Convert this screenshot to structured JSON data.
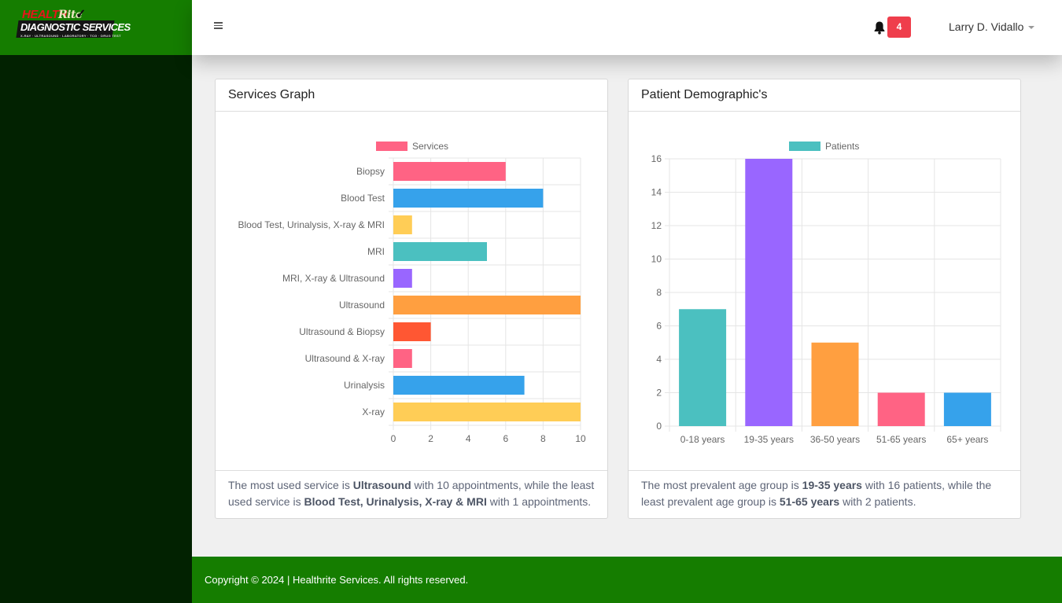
{
  "brand": {
    "logo_line1": "HEALTH",
    "logo_line1b": "Rite",
    "logo_line2": "DIAGNOSTIC SERVICES",
    "logo_line3": "X-RAY · ULTRASOUND · LABORATORY · TCG · DRUG TEST"
  },
  "header": {
    "notification_count": "4",
    "user_name": "Larry D. Vidallo"
  },
  "services_card": {
    "title": "Services Graph",
    "summary": {
      "t1": "The most used service is ",
      "most_service": "Ultrasound",
      "t2": " with 10 appointments, while the least used service is ",
      "least_service": "Blood Test, Urinalysis, X-ray & MRI",
      "t3": " with 1 appointments."
    }
  },
  "demographics_card": {
    "title": "Patient Demographic's",
    "summary": {
      "t1": "The most prevalent age group is ",
      "most_group": "19-35 years",
      "t2": " with 16 patients, while the least prevalent age group is ",
      "least_group": "51-65 years",
      "t3": " with 2 patients."
    }
  },
  "chart_data": [
    {
      "type": "bar",
      "orientation": "horizontal",
      "categories": [
        "Biopsy",
        "Blood Test",
        "Blood Test, Urinalysis, X-ray & MRI",
        "MRI",
        "MRI, X-ray & Ultrasound",
        "Ultrasound",
        "Ultrasound & Biopsy",
        "Ultrasound & X-ray",
        "Urinalysis",
        "X-ray"
      ],
      "series": [
        {
          "name": "Services",
          "values": [
            6,
            8,
            1,
            5,
            1,
            10,
            2,
            1,
            7,
            10
          ]
        }
      ],
      "colors": [
        "#ff6384",
        "#36a2eb",
        "#ffcd56",
        "#4bc0c0",
        "#9966ff",
        "#ff9f40",
        "#ff5733",
        "#ff6384",
        "#36a2eb",
        "#ffcd56"
      ],
      "legend_color": "#ff6384",
      "xlim": [
        0,
        10
      ],
      "xticks": [
        0,
        2,
        4,
        6,
        8,
        10
      ],
      "grid": true,
      "legend": "top"
    },
    {
      "type": "bar",
      "orientation": "vertical",
      "categories": [
        "0-18 years",
        "19-35 years",
        "36-50 years",
        "51-65 years",
        "65+ years"
      ],
      "series": [
        {
          "name": "Patients",
          "values": [
            7,
            16,
            5,
            2,
            2
          ]
        }
      ],
      "colors": [
        "#4bc0c0",
        "#9966ff",
        "#ff9f40",
        "#ff6384",
        "#36a2eb"
      ],
      "legend_color": "#4bc0c0",
      "ylim": [
        0,
        16
      ],
      "yticks": [
        0,
        2,
        4,
        6,
        8,
        10,
        12,
        14,
        16
      ],
      "grid": true,
      "legend": "top"
    }
  ],
  "footer": {
    "copyright": "Copyright © 2024 | Healthrite Services. All rights reserved."
  }
}
